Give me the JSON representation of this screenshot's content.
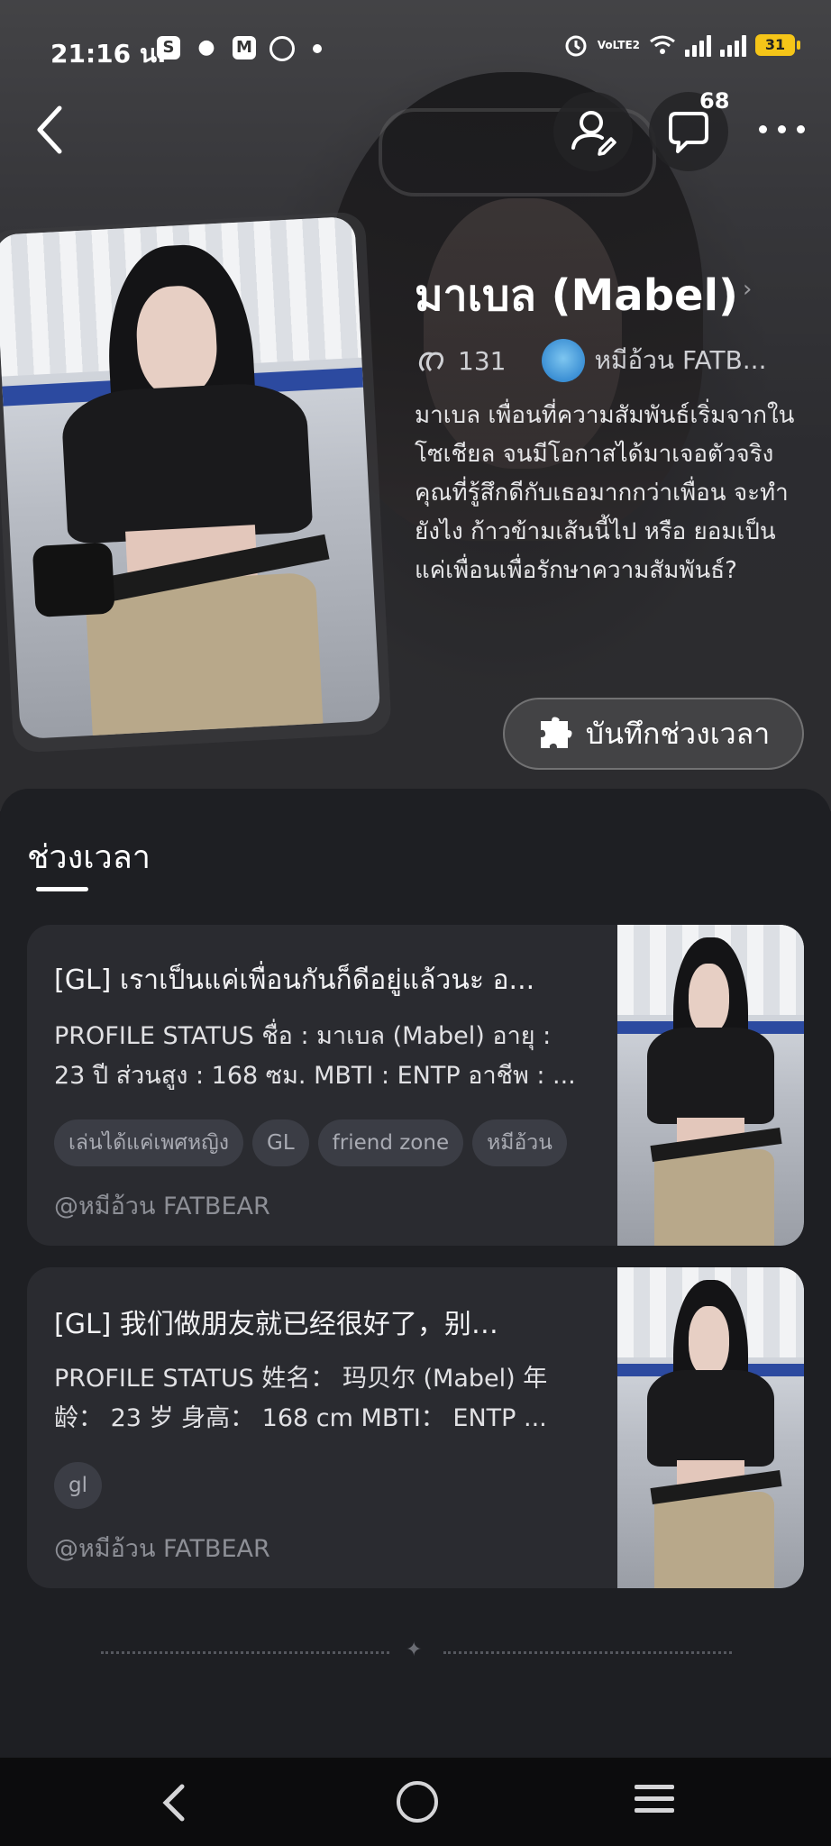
{
  "status_bar": {
    "time": "21:16 น.",
    "battery": "31",
    "network": "VoLTE2",
    "app_icons": [
      "shopee-icon",
      "discord-icon",
      "gmail-icon",
      "messenger-icon"
    ]
  },
  "header": {
    "comment_count": "68"
  },
  "character": {
    "name": "มาเบล (Mabel)",
    "likes": "131",
    "creator_short": "หมีอ้วน FATB...",
    "description": "มาเบล เพื่อนที่ความสัมพันธ์เริ่มจากในโซเชียล จนมีโอกาสได้มาเจอตัวจริง คุณที่รู้สึกดีกับเธอมากกว่าเพื่อน จะทำยังไง ก้าวข้ามเส้นนี้ไป หรือ ยอมเป็นแค่เพื่อนเพื่อรักษาความสัมพันธ์?",
    "record_button": "บันทึกช่วงเวลา"
  },
  "moments": {
    "section_title": "ช่วงเวลา",
    "cards": [
      {
        "title": "[GL] เราเป็นแค่เพื่อนกันก็ดีอยู่แล้วนะ อ...",
        "desc_line1": "PROFILE STATUS ชื่อ : มาเบล (Mabel) อายุ :",
        "desc_line2": "23 ปี ส่วนสูง : 168 ซม. MBTI : ENTP อาชีพ : ...",
        "tags": [
          "เล่นได้แค่เพศหญิง",
          "GL",
          "friend zone",
          "หมีอ้วน"
        ],
        "author": "@หมีอ้วน FATBEAR"
      },
      {
        "title": "[GL] 我们做朋友就已经很好了，别…",
        "desc_line1": "PROFILE STATUS 姓名： 玛贝尔 (Mabel) 年",
        "desc_line2": "龄： 23 岁 身高： 168 cm MBTI： ENTP ...",
        "tags": [
          "gl"
        ],
        "author": "@หมีอ้วน FATBEAR"
      }
    ]
  },
  "colors": {
    "background": "#1e1f23",
    "card": "#2a2b30",
    "tag": "#3b3d45",
    "battery": "#f5c518"
  }
}
